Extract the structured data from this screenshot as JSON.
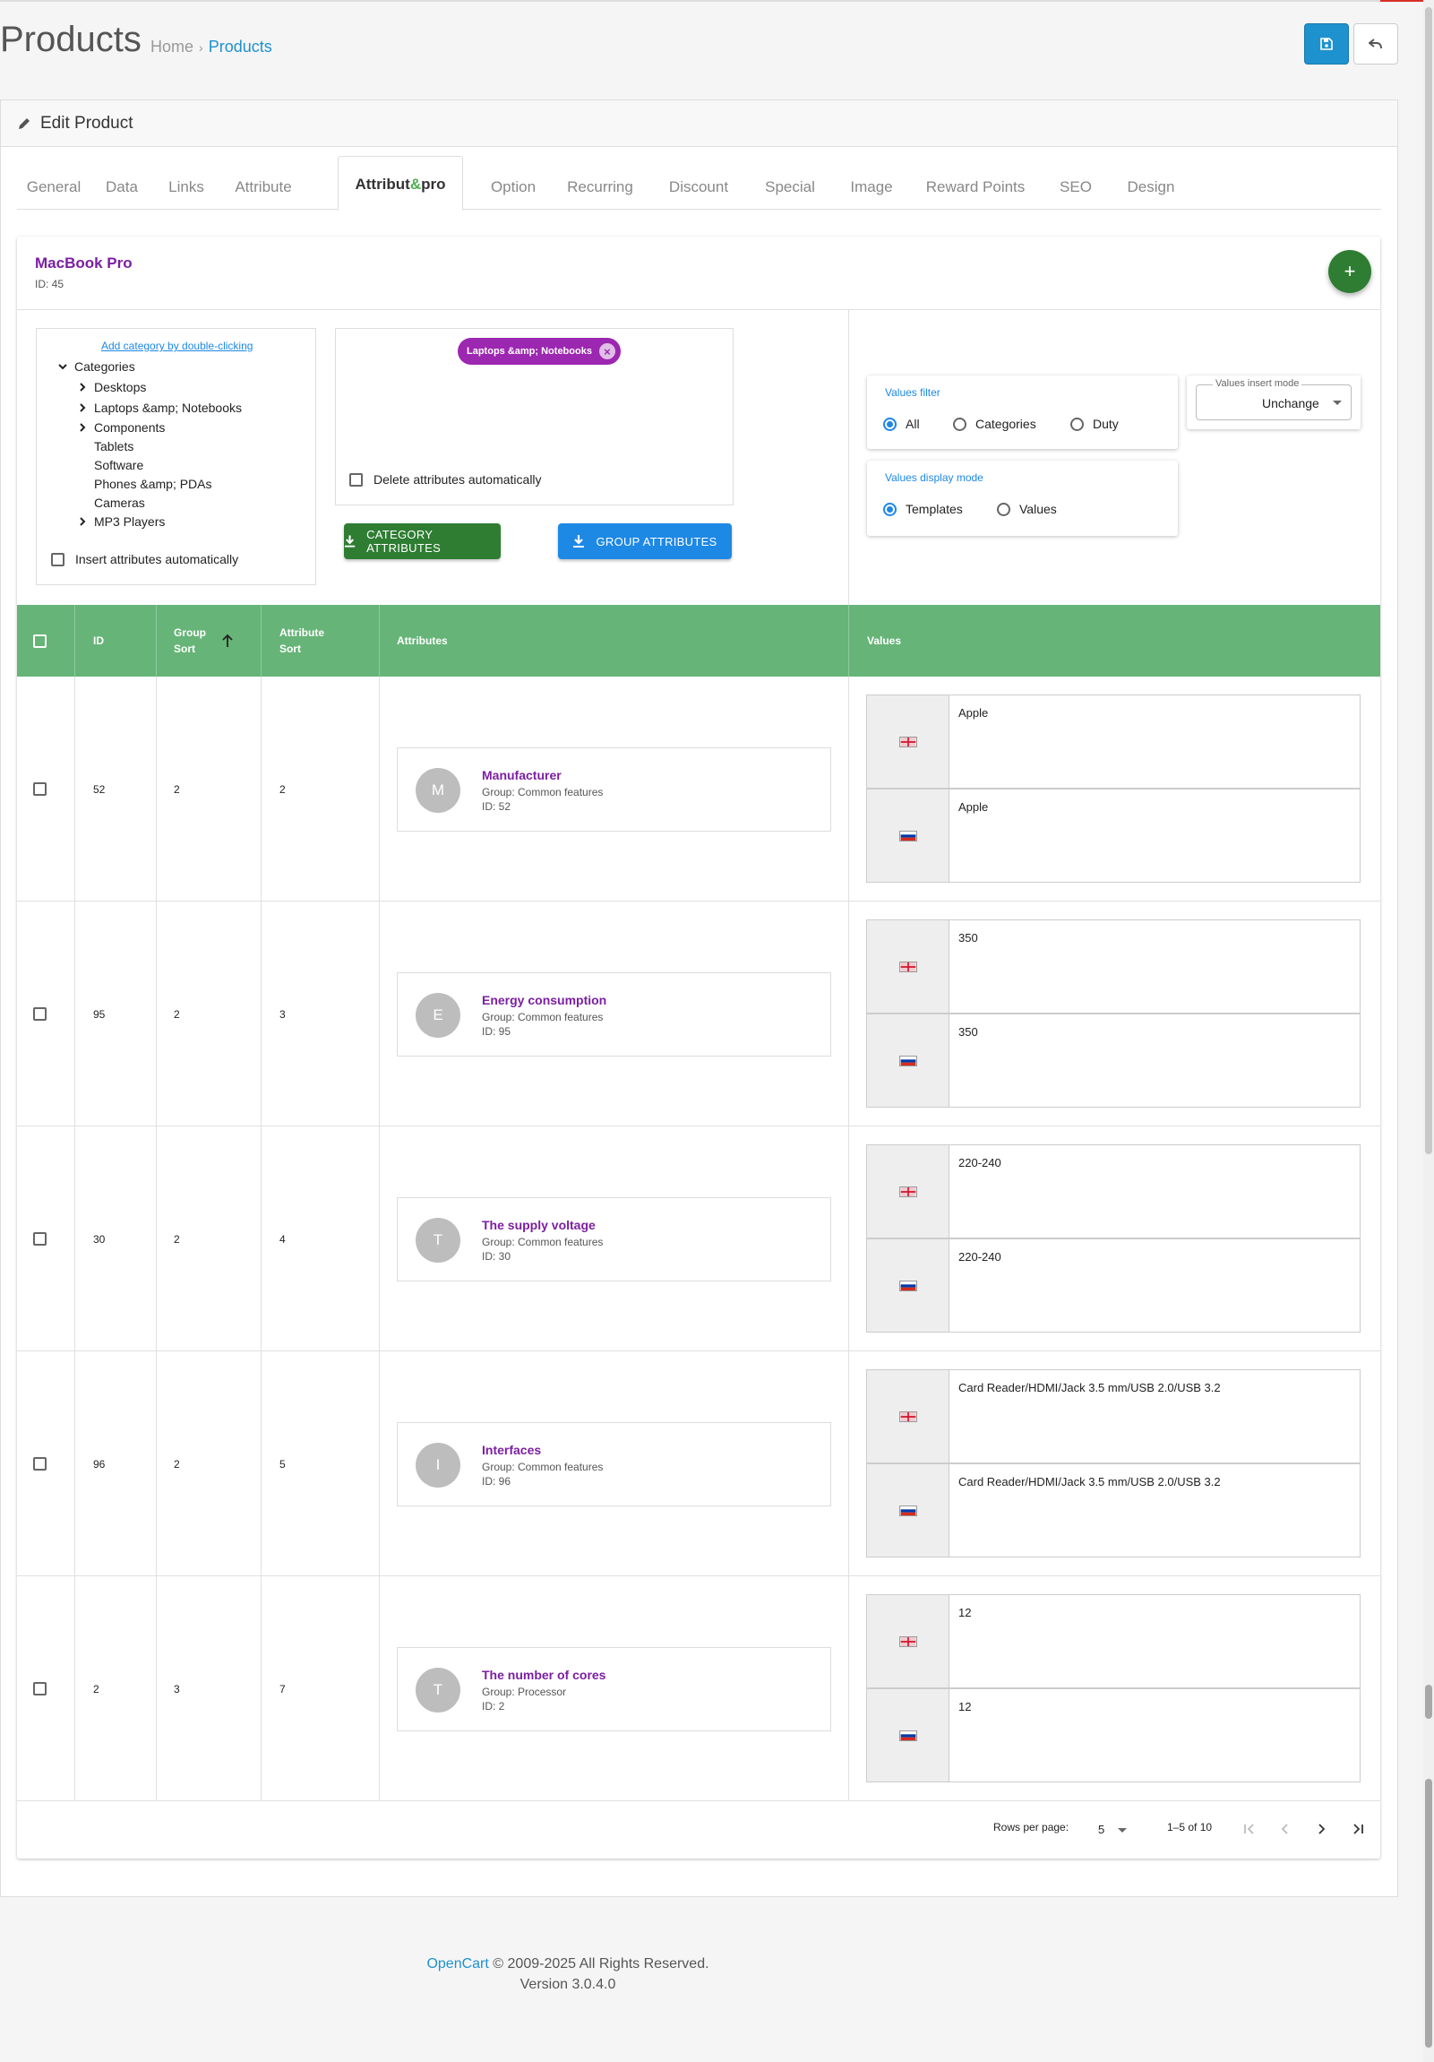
{
  "header": {
    "title": "Products",
    "breadcrumb": [
      "Home",
      "Products"
    ],
    "breadcrumb_separator": "›",
    "save_icon": "save-icon",
    "back_icon": "reply-icon"
  },
  "panel": {
    "title": "Edit Product",
    "icon": "pencil-icon"
  },
  "tabs": [
    "General",
    "Data",
    "Links",
    "Attribute",
    "Attribut",
    "Option",
    "Recurring",
    "Discount",
    "Special",
    "Image",
    "Reward Points",
    "SEO",
    "Design"
  ],
  "active_tab": {
    "part1": "Attribut",
    "amp": "&",
    "part2": "pro"
  },
  "product": {
    "name": "MacBook Pro",
    "id_label": "ID: 45"
  },
  "categories": {
    "hint": "Add category by double-clicking",
    "root": "Categories",
    "items": [
      "Desktops",
      "Laptops &amp; Notebooks",
      "Components",
      "Tablets",
      "Software",
      "Phones &amp; PDAs",
      "Cameras",
      "MP3 Players"
    ],
    "insert_auto_label": "Insert attributes automatically"
  },
  "selected_categories": {
    "chip": "Laptops &amp; Notebooks",
    "delete_auto_label": "Delete attributes automatically"
  },
  "buttons": {
    "category_attributes": "CATEGORY ATTRIBUTES",
    "group_attributes": "GROUP ATTRIBUTES"
  },
  "values_filter": {
    "title": "Values filter",
    "options": [
      "All",
      "Categories",
      "Duty"
    ],
    "selected": "All"
  },
  "values_display": {
    "title": "Values display mode",
    "options": [
      "Templates",
      "Values"
    ],
    "selected": "Templates"
  },
  "insert_mode": {
    "legend": "Values insert mode",
    "value": "Unchange"
  },
  "table": {
    "headers": {
      "id": "ID",
      "group_sort_1": "Group",
      "group_sort_2": "Sort",
      "attr_sort_1": "Attribute",
      "attr_sort_2": "Sort",
      "attributes": "Attributes",
      "values": "Values"
    },
    "rows": [
      {
        "id": "52",
        "group_sort": "2",
        "attr_sort": "2",
        "avatar": "M",
        "name": "Manufacturer",
        "group": "Group: Common features",
        "id_label": "ID: 52",
        "value_en": "Apple",
        "value_ru": "Apple"
      },
      {
        "id": "95",
        "group_sort": "2",
        "attr_sort": "3",
        "avatar": "E",
        "name": "Energy consumption",
        "group": "Group: Common features",
        "id_label": "ID: 95",
        "value_en": "350",
        "value_ru": "350"
      },
      {
        "id": "30",
        "group_sort": "2",
        "attr_sort": "4",
        "avatar": "T",
        "name": "The supply voltage",
        "group": "Group: Common features",
        "id_label": "ID: 30",
        "value_en": "220-240",
        "value_ru": "220-240"
      },
      {
        "id": "96",
        "group_sort": "2",
        "attr_sort": "5",
        "avatar": "I",
        "name": "Interfaces",
        "group": "Group: Common features",
        "id_label": "ID: 96",
        "value_en": "Card Reader/HDMI/Jack 3.5 mm/USB 2.0/USB 3.2",
        "value_ru": "Card Reader/HDMI/Jack 3.5 mm/USB 2.0/USB 3.2"
      },
      {
        "id": "2",
        "group_sort": "3",
        "attr_sort": "7",
        "avatar": "T",
        "name": "The number of cores",
        "group": "Group: Processor",
        "id_label": "ID: 2",
        "value_en": "12",
        "value_ru": "12"
      }
    ]
  },
  "pagination": {
    "rows_per_page_label": "Rows per page:",
    "rows_per_page": "5",
    "range": "1–5 of 10"
  },
  "footer": {
    "brand": "OpenCart",
    "copyright": "© 2009-2025 All Rights Reserved.",
    "version": "Version 3.0.4.0"
  },
  "colors": {
    "primary": "#1e91cf",
    "accent_purple": "#7b1fa2",
    "green": "#2e7d32",
    "table_header": "#66b478"
  }
}
